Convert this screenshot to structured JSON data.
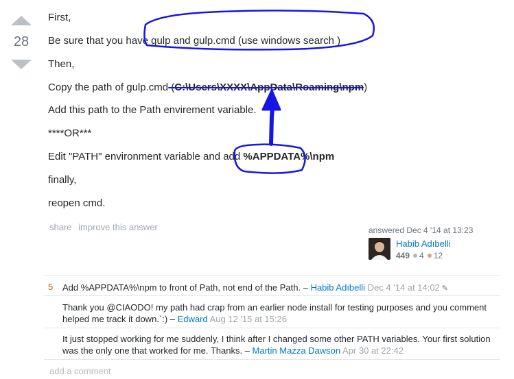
{
  "vote": {
    "count": "28"
  },
  "answer": {
    "lines": {
      "first": "First,",
      "be_sure": "Be sure that you have gulp and gulp.cmd (use windows search )",
      "then": "Then,",
      "copy_prefix": "Copy the path of gulp.cmd (",
      "copy_path": "C:\\Users\\XXXX\\AppData\\Roaming\\npm",
      "copy_suffix": ")",
      "add_path": "Add this path to the Path envirement variable.",
      "or": "****OR***",
      "edit_prefix": "Edit \"PATH\" environment variable and add ",
      "edit_value": "%APPDATA%\\npm",
      "finally": "finally,",
      "reopen": "reopen cmd."
    },
    "menu": {
      "share": "share",
      "improve": "improve this answer"
    }
  },
  "user_card": {
    "answered": "answered Dec 4 '14 at 13:23",
    "name": "Habib Adıbelli",
    "reputation": "449",
    "silver": "4",
    "bronze": "12",
    "colors": {
      "silver": "#b4b8bc",
      "bronze": "#d1a684"
    }
  },
  "comments": [
    {
      "score": "5",
      "text": "Add %APPDATA%\\npm to front of Path, not end of the Path. – ",
      "user": "Habib Adıbelli",
      "date": " Dec 4 '14 at 14:02",
      "edited_icon": "pencil-icon"
    },
    {
      "score": "",
      "text": "Thank you @CIAODO! my path had crap from an earlier node install for testing purposes and you comment helped me track it down.`:) – ",
      "user": "Edward",
      "date": " Aug 12 '15 at 15:26"
    },
    {
      "score": "",
      "text": "It just stopped working for me suddenly, I think after I changed some other PATH variables. Your first solution was the only one that worked for me. Thanks. – ",
      "user": "Martin Mazza Dawson",
      "date": " Apr 30 at 22:42"
    }
  ],
  "add_comment": "add a comment",
  "annotation_color": "#1515e6"
}
